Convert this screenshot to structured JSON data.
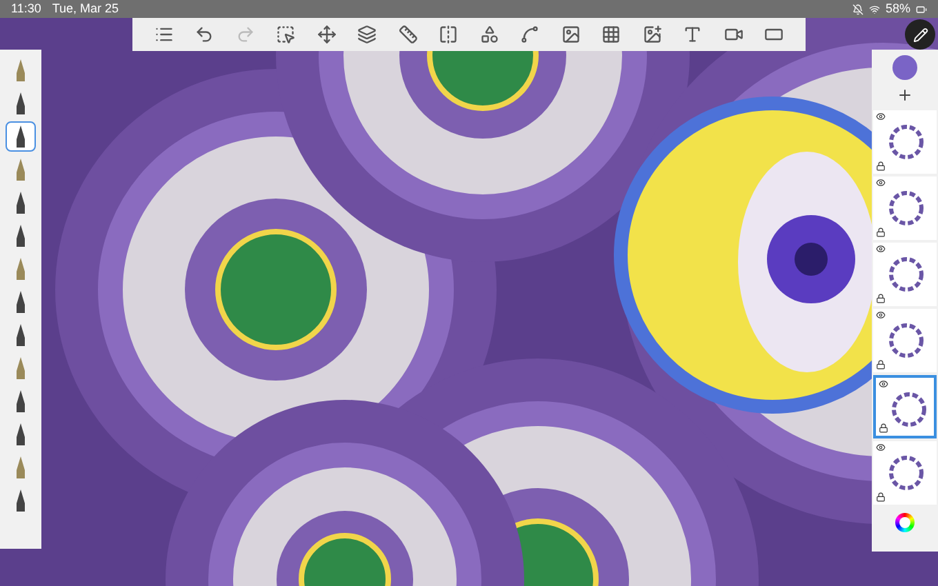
{
  "status_bar": {
    "time": "11:30",
    "date": "Tue, Mar 25",
    "battery": "58%"
  },
  "brushes": [
    {
      "selected": false
    },
    {
      "selected": false
    },
    {
      "selected": true
    },
    {
      "selected": false
    },
    {
      "selected": false
    },
    {
      "selected": false
    },
    {
      "selected": false
    },
    {
      "selected": false
    },
    {
      "selected": false
    },
    {
      "selected": false
    },
    {
      "selected": false
    },
    {
      "selected": false
    },
    {
      "selected": false
    },
    {
      "selected": false
    }
  ],
  "color_swatch": {
    "color": "#7a64c6"
  },
  "layers": [
    {
      "selected": false,
      "visible": true
    },
    {
      "selected": false,
      "visible": true
    },
    {
      "selected": false,
      "visible": true
    },
    {
      "selected": false,
      "visible": true
    },
    {
      "selected": true,
      "visible": true
    },
    {
      "selected": false,
      "visible": true
    }
  ]
}
